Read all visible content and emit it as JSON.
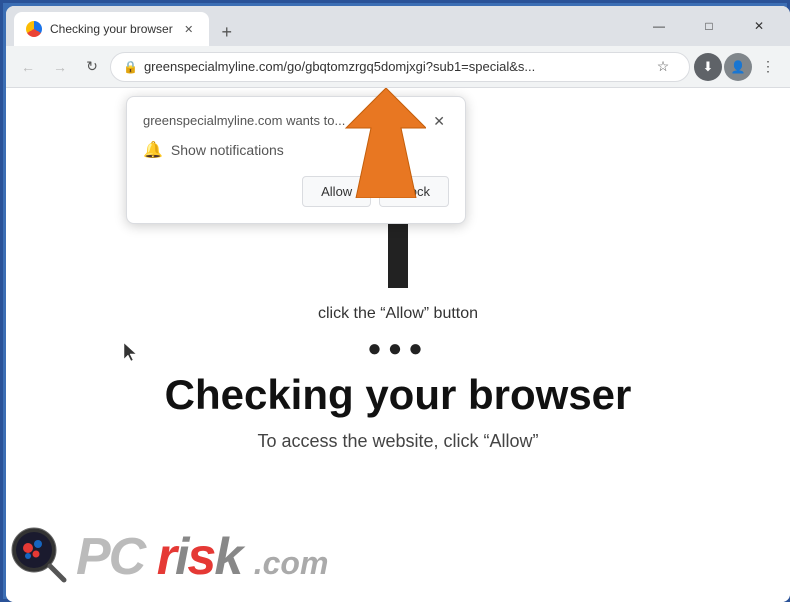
{
  "browser": {
    "tab_title": "Checking your browser",
    "url": "greenspecialmyline.com/go/gbqtomzrgq5domjxgi?sub1=special&s...",
    "nav": {
      "back": "←",
      "forward": "→",
      "reload": "↺"
    },
    "window_controls": {
      "minimize": "—",
      "maximize": "□",
      "close": "✕"
    },
    "new_tab": "+"
  },
  "popup": {
    "site_text": "greenspecialmyline.com wants to...",
    "close_icon": "✕",
    "notification_text": "Show notifications",
    "allow_btn": "Allow",
    "block_btn": "Block"
  },
  "page": {
    "click_allow_text": "click the “Allow” button",
    "three_dots": "●●●",
    "heading": "Checking your browser",
    "sub_text": "To access the website, click “Allow”"
  },
  "logo": {
    "text_pc": "PC",
    "text_risk": "risk",
    "text_com": ".com"
  },
  "icons": {
    "lock": "🔒",
    "star": "☆",
    "bell": "🔔",
    "menu_dots": "⋮"
  }
}
